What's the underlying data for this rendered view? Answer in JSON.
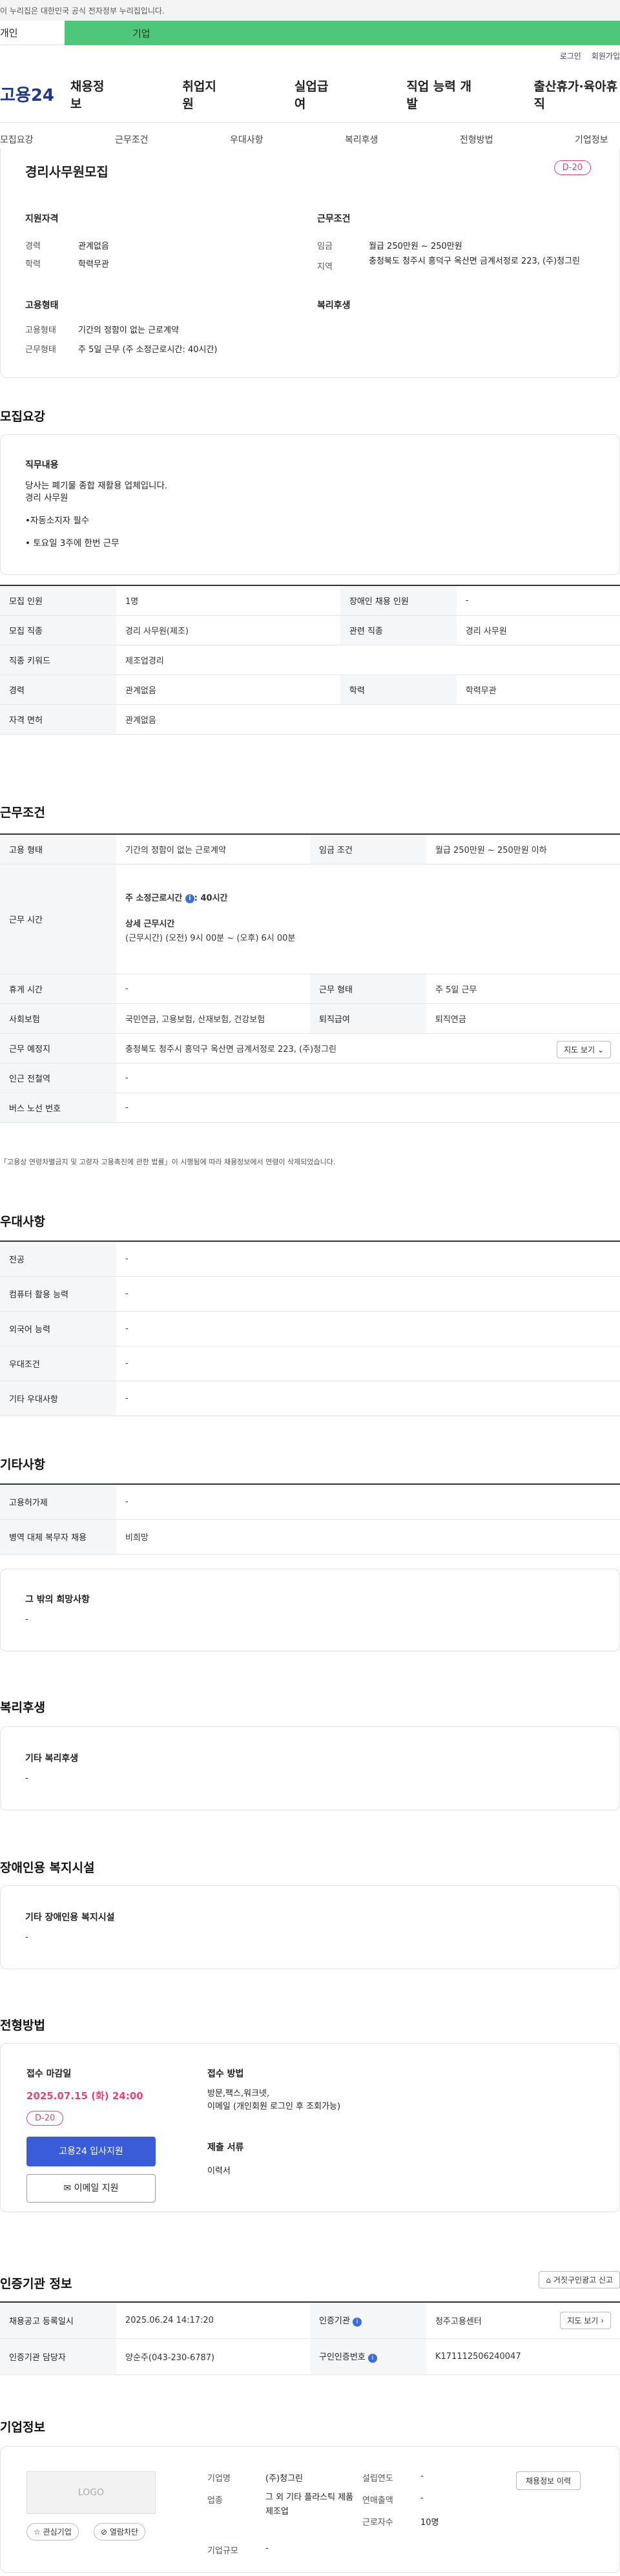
{
  "gov_banner": "이 누리집은 대한민국 공식 전자정부 누리집입니다.",
  "mode_tabs": {
    "personal": "개인",
    "business": "기업"
  },
  "util": {
    "login": "로그인",
    "join": "회원가입"
  },
  "logo": "고용24",
  "gnb": [
    "채용정보",
    "취업지원",
    "실업급여",
    "직업 능력 개발",
    "출산휴가·육아휴직"
  ],
  "snb": [
    "모집요강",
    "근무조건",
    "우대사항",
    "복리후생",
    "전형방법",
    "기업정보"
  ],
  "summary": {
    "title": "경리사무원모집",
    "dday": "D-20",
    "qual_title": "지원자격",
    "career_label": "경력",
    "career_value": "관계없음",
    "edu_label": "학력",
    "edu_value": "학력무관",
    "work_title": "근무조건",
    "wage_label": "임금",
    "wage_value": "월급 250만원 ~ 250만원",
    "area_label": "지역",
    "area_value": "충청북도 청주시 흥덕구 옥산면 금계서정로 223, (주)청그린",
    "emp_title": "고용형태",
    "type_label": "고용형태",
    "type_value": "기간의 정함이 없는 근로계약",
    "hours_label": "근무형태",
    "hours_value": "주 5일 근무 (주 소정근로시간: 40시간)",
    "welfare_title": "복리후생"
  },
  "recruit": {
    "section": "모집요강",
    "duty_title": "직무내용",
    "duty_lines": [
      "당사는 폐기물 종합 재활용 업체입니다.",
      "경리 사무원",
      "",
      "•자동소지자 필수",
      "",
      "• 토요일 3주에 한번 근무"
    ],
    "rows": [
      [
        "모집 인원",
        "1명",
        "장애인 채용 인원",
        "-"
      ],
      [
        "모집 직종",
        "경리 사무원(제조)",
        "관련 직종",
        "경리 사무원"
      ],
      [
        "직종 키워드",
        "제조업경리",
        "",
        ""
      ],
      [
        "경력",
        "관계없음",
        "학력",
        "학력무관"
      ],
      [
        "자격 면허",
        "관계없음",
        "",
        ""
      ]
    ]
  },
  "work": {
    "section": "근무조건",
    "type_h": "고용 형태",
    "type_v": "기간의 정함이 없는 근로계약",
    "wage_h": "임금 조건",
    "wage_v": "월급 250만원 ~ 250만원 이하",
    "time_h": "근무 시간",
    "time_week": "주 소정근로시간",
    "time_week_v": ": 40시간",
    "time_detail_title": "상세 근무시간",
    "time_detail": "(근무시간) (오전) 9시 00분 ~ (오후) 6시 00분",
    "rest_h": "휴게 시간",
    "rest_v": "-",
    "shape_h": "근무 형태",
    "shape_v": "주 5일 근무",
    "ins_h": "사회보험",
    "ins_v": "국민연금, 고용보험, 산재보험, 건강보험",
    "ret_h": "퇴직급여",
    "ret_v": "퇴직연금",
    "place_h": "근무 예정지",
    "place_v": "충청북도 청주시 흥덕구 옥산면 금계서정로 223, (주)청그린",
    "map_btn": "지도 보기",
    "station_h": "인근 전철역",
    "station_v": "-",
    "bus_h": "버스 노선 번호",
    "bus_v": "-",
    "note": "「고용상 연령차별금지 및 고령자 고용촉진에 관한 법률」이 시행됨에 따라 채용정보에서 연령이 삭제되었습니다."
  },
  "pref": {
    "section": "우대사항",
    "rows": [
      [
        "전공",
        "-"
      ],
      [
        "컴퓨터 활용 능력",
        "-"
      ],
      [
        "외국어 능력",
        "-"
      ],
      [
        "우대조건",
        "-"
      ],
      [
        "기타 우대사항",
        "-"
      ]
    ]
  },
  "etc": {
    "section": "기타사항",
    "rows": [
      [
        "고용허가제",
        "-"
      ],
      [
        "병역 대체 복무자 채용",
        "비희망"
      ]
    ],
    "other_title": "그 밖의 희망사항",
    "other_value": "-"
  },
  "welfare": {
    "section": "복리후생",
    "title": "기타 복리후생",
    "value": "-"
  },
  "disabled": {
    "section": "장애인용 복지시설",
    "title": "기타 장애인용 복지시설",
    "value": "-"
  },
  "apply": {
    "section": "전형방법",
    "deadline_title": "접수 마감일",
    "deadline": "2025.07.15 (화) 24:00",
    "dday": "D-20",
    "apply_btn": "고용24 입사지원",
    "email_btn": "이메일 지원",
    "method_title": "접수 방법",
    "method_lines": [
      "방문,팩스,워크넷,",
      "이메일 (개인회원 로그인 후 조회가능)"
    ],
    "docs_title": "제출 서류",
    "docs_value": "이력서"
  },
  "agency": {
    "section": "인증기관 정보",
    "report_btn": "거짓구인광고 신고",
    "reg_h": "채용공고 등록일시",
    "reg_v": "2025.06.24 14:17:20",
    "org_h": "인증기관",
    "org_v": "청주고용센터",
    "map_btn": "지도 보기",
    "mgr_h": "인증기관 담당자",
    "mgr_v": "양순주(043-230-6787)",
    "num_h": "구인인증번호",
    "num_v": "K171112506240047"
  },
  "company": {
    "section": "기업정보",
    "logo": "LOGO",
    "fav_btn": "관심기업",
    "block_btn": "열람차단",
    "name_h": "기업명",
    "name_v": "(주)청그린",
    "ind_h": "업종",
    "ind_v": "그 외 기타 플라스틱 제품 제조업",
    "size_h": "기업규모",
    "size_v": "-",
    "year_h": "설립연도",
    "year_v": "-",
    "sales_h": "연매출액",
    "sales_v": "-",
    "emp_h": "근로자수",
    "emp_v": "10명",
    "history_btn": "채용정보 이력"
  }
}
